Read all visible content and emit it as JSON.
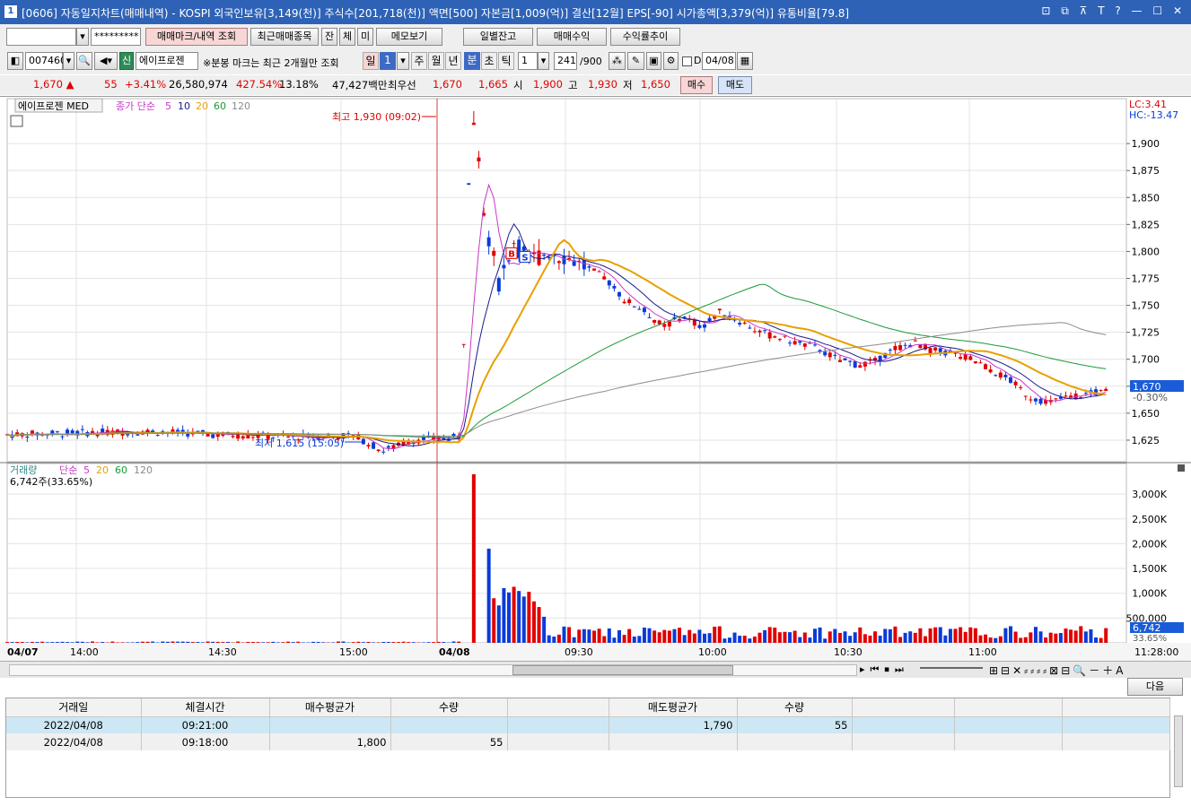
{
  "window": {
    "number": "1",
    "title": "[0606] 자동일지차트(매매내역) - KOSPI 외국인보유[3,149(천)] 주식수[201,718(천)] 액면[500] 자본금[1,009(억)] 결산[12월] EPS[-90] 시가총액[3,379(억)] 유통비율[79.8]",
    "title_icons": "⊡ ⧉ ⊼ T ? — ☐ ✕"
  },
  "toolbar1": {
    "account_value": "",
    "password_value": "*********",
    "trade_mark_btn": "매매마크/내역 조회",
    "recent_btn": "최근매매종목",
    "jan_btn": "잔",
    "che_btn": "체",
    "mi_btn": "미",
    "memo_btn": "메모보기",
    "daily_balance_btn": "일별잔고",
    "trade_profit_btn": "매매수익",
    "return_trend_btn": "수익률추이"
  },
  "toolbar2": {
    "code": "007460",
    "sin_badge": "신",
    "stock_name": "에이프로젠",
    "notice": "※분봉 마크는 최근 2개월만 조회",
    "periods": [
      {
        "label": "일",
        "active": false
      },
      {
        "label": "1",
        "active": true
      },
      {
        "label": "주",
        "active": false
      },
      {
        "label": "월",
        "active": false
      },
      {
        "label": "년",
        "active": false
      },
      {
        "label": "분",
        "active": true
      },
      {
        "label": "초",
        "active": false
      },
      {
        "label": "틱",
        "active": false
      }
    ],
    "interval_value": "1",
    "count_value": "241",
    "count_max": "/900",
    "date_label": "D",
    "date_value": "04/08"
  },
  "quote": {
    "price": "1,670 ▲",
    "change": "55",
    "change_pct": "+3.41%",
    "volume": "26,580,974",
    "vol_ratio": "427.54%",
    "turnover": "13.18%",
    "amount": "47,427백만",
    "best_ask_label": "최우선",
    "best_ask": "1,670",
    "best_bid": "1,665",
    "open_label": "시",
    "open": "1,900",
    "high_label": "고",
    "high": "1,930",
    "low_label": "저",
    "low": "1,650",
    "buy_btn": "매수",
    "sell_btn": "매도"
  },
  "price_panel": {
    "stock_tag": "에이프로젠 MED",
    "ma_label": "종가 단순",
    "ma_periods": [
      "5",
      "10",
      "20",
      "60",
      "120"
    ],
    "lc": "LC:3.41",
    "hc": "HC:-13.47",
    "high_annotation": "최고 1,930 (09:02)",
    "low_annotation": "최저 1,615 (15:05)",
    "current_price_tag": "1,670",
    "current_pct_tag": "-0.30%",
    "trade_marks": [
      "B",
      "S"
    ]
  },
  "volume_panel": {
    "label": "거래량",
    "ma_label": "단순",
    "ma_periods": [
      "5",
      "20",
      "60",
      "120"
    ],
    "current_volume": "6,742주(33.65%)",
    "current_tag": "6,742",
    "current_pct_tag": "33.65%"
  },
  "xaxis": {
    "date_labels": [
      "04/07",
      "04/08"
    ],
    "time_labels": [
      "14:00",
      "14:30",
      "15:00",
      "09:30",
      "10:00",
      "10:30",
      "11:00"
    ],
    "right_time": "11:28:00"
  },
  "colors": {
    "titlebar": "#2e62b6",
    "up": "#e00000",
    "down": "#0a3bd8",
    "ma5": "#c838c8",
    "ma10": "#1a1a8c",
    "ma20": "#e8a000",
    "ma60": "#1a9a3a",
    "ma120": "#8c8c8c"
  },
  "chart_data": {
    "type": "candlestick",
    "yaxis_price": [
      1625,
      1650,
      1675,
      1700,
      1725,
      1750,
      1775,
      1800,
      1825,
      1850,
      1875,
      1900
    ],
    "yaxis_volume": [
      "500,000",
      "1,000K",
      "1,500K",
      "2,000K",
      "2,500K",
      "3,000K"
    ],
    "price_path": [
      [
        0,
        1630
      ],
      [
        0.08,
        1632
      ],
      [
        0.15,
        1633
      ],
      [
        0.22,
        1630
      ],
      [
        0.29,
        1628
      ],
      [
        0.36,
        1629
      ],
      [
        0.39,
        1615
      ],
      [
        0.42,
        1625
      ],
      [
        0.44,
        1626
      ],
      [
        0.47,
        1628
      ],
      [
        0.48,
        1905
      ],
      [
        0.485,
        1930
      ],
      [
        0.495,
        1830
      ],
      [
        0.51,
        1770
      ],
      [
        0.525,
        1810
      ],
      [
        0.54,
        1790
      ],
      [
        0.56,
        1800
      ],
      [
        0.58,
        1795
      ],
      [
        0.6,
        1785
      ],
      [
        0.62,
        1775
      ],
      [
        0.64,
        1755
      ],
      [
        0.66,
        1745
      ],
      [
        0.68,
        1730
      ],
      [
        0.7,
        1740
      ],
      [
        0.72,
        1730
      ],
      [
        0.74,
        1745
      ],
      [
        0.76,
        1735
      ],
      [
        0.78,
        1725
      ],
      [
        0.8,
        1720
      ],
      [
        0.82,
        1715
      ],
      [
        0.84,
        1710
      ],
      [
        0.86,
        1700
      ],
      [
        0.88,
        1695
      ],
      [
        0.9,
        1698
      ],
      [
        0.92,
        1710
      ],
      [
        0.94,
        1715
      ],
      [
        0.96,
        1708
      ],
      [
        0.98,
        1705
      ],
      [
        1.0,
        1700
      ],
      [
        1.02,
        1690
      ],
      [
        1.04,
        1680
      ],
      [
        1.06,
        1665
      ],
      [
        1.08,
        1660
      ],
      [
        1.1,
        1665
      ],
      [
        1.12,
        1668
      ],
      [
        1.14,
        1670
      ]
    ],
    "trades": [
      {
        "date": "2022/04/08",
        "time": "09:21:00",
        "side": "sell",
        "price": 1790,
        "qty": 55
      },
      {
        "date": "2022/04/08",
        "time": "09:18:00",
        "side": "buy",
        "price": 1800,
        "qty": 55
      }
    ]
  },
  "scroll": {
    "next_btn": "다음"
  },
  "grid": {
    "headers": [
      "거래일",
      "체결시간",
      "매수평균가",
      "수량",
      "",
      "매도평균가",
      "수량",
      "",
      "",
      ""
    ],
    "rows": [
      [
        "2022/04/08",
        "09:21:00",
        "",
        "",
        "",
        "1,790",
        "55",
        "",
        "",
        ""
      ],
      [
        "2022/04/08",
        "09:18:00",
        "1,800",
        "55",
        "",
        "",
        "",
        "",
        "",
        ""
      ]
    ]
  }
}
